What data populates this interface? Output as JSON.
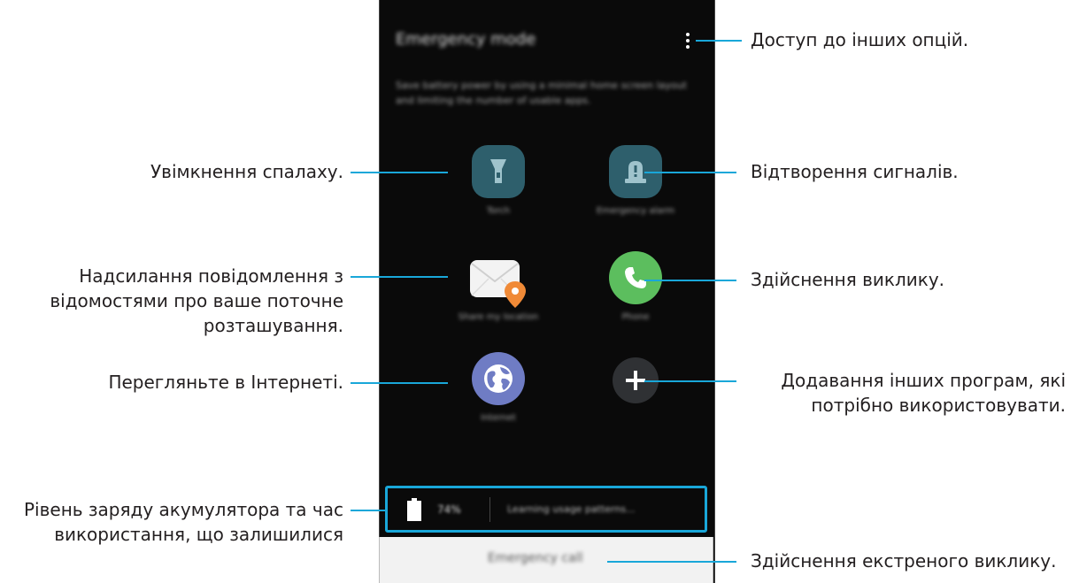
{
  "phone": {
    "title": "Emergency mode",
    "description": "Save battery power by using a minimal home screen layout and limiting the number of usable apps.",
    "apps": [
      {
        "label": "Torch"
      },
      {
        "label": "Emergency alarm"
      },
      {
        "label": "Share my location"
      },
      {
        "label": "Phone"
      },
      {
        "label": "Internet"
      },
      {
        "label": ""
      }
    ],
    "battery_percent": "74%",
    "battery_usage": "Learning usage patterns...",
    "emergency_call": "Emergency call"
  },
  "callouts": {
    "more_options": "Доступ до інших опцій.",
    "flashlight": "Увімкнення спалаху.",
    "alarm": "Відтворення сигналів.",
    "location_line1": "Надсилання повідомлення з",
    "location_line2": "відомостями про ваше поточне",
    "location_line3": "розташування.",
    "call": "Здійснення виклику.",
    "internet": "Перегляньте в Інтернеті.",
    "add_line1": "Додавання інших програм, які",
    "add_line2": "потрібно використовувати.",
    "battery_line1": "Рівень заряду акумулятора та час",
    "battery_line2": "використання, що залишилися",
    "emergency": "Здійснення екстреного виклику."
  },
  "colors": {
    "callout_line": "#19a7d9",
    "teal_icon": "#2e5f6c",
    "green_icon": "#5cbe5e",
    "purple_icon": "#6f7cc4"
  }
}
